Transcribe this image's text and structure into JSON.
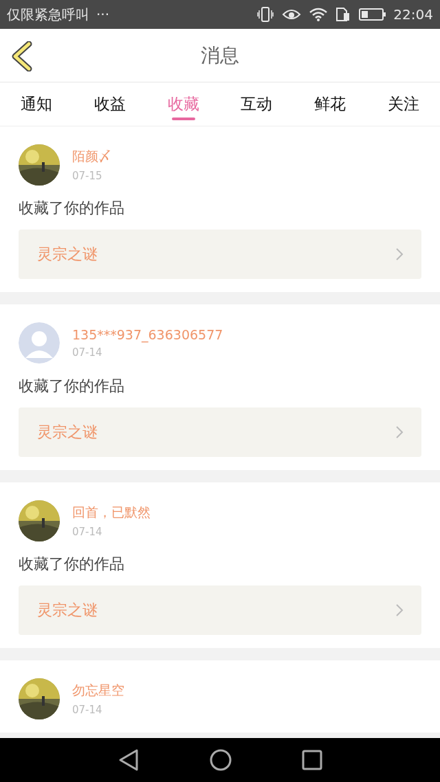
{
  "status_bar": {
    "carrier": "仅限紧急呼叫",
    "more": "···",
    "time": "22:04"
  },
  "header": {
    "title": "消息"
  },
  "tabs": [
    {
      "label": "通知",
      "selected": false
    },
    {
      "label": "收益",
      "selected": false
    },
    {
      "label": "收藏",
      "selected": true
    },
    {
      "label": "互动",
      "selected": false
    },
    {
      "label": "鲜花",
      "selected": false
    },
    {
      "label": "关注",
      "selected": false
    }
  ],
  "messages": [
    {
      "name": "陌颜〆",
      "date": "07-15",
      "action": "收藏了你的作品",
      "work": "灵宗之谜"
    },
    {
      "avatar": {
        "kind": "placeholder"
      },
      "name": "135***937_636306577",
      "date": "07-14",
      "action": "收藏了你的作品",
      "work": "灵宗之谜"
    },
    {
      "name": "回首，已默然",
      "date": "07-14",
      "action": "收藏了你的作品",
      "work": "灵宗之谜"
    },
    {
      "name": "勿忘星空",
      "date": "07-14"
    }
  ]
}
